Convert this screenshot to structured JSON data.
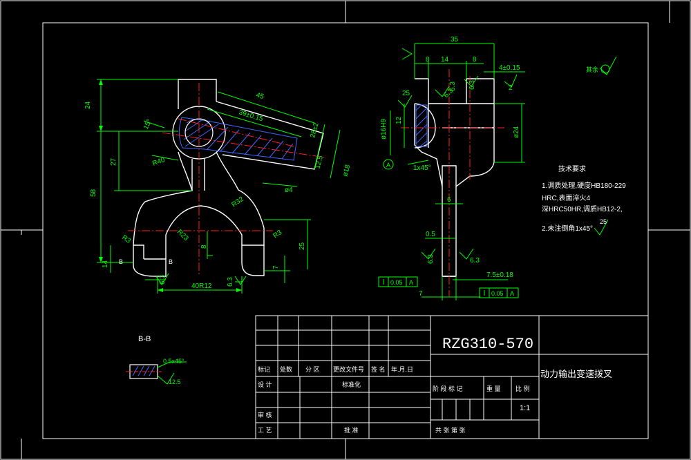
{
  "colors": {
    "background": "#000000",
    "outline": "#ffffff",
    "dimension": "#00ff00",
    "centerline": "#ff0000",
    "hatch": "#0000ff",
    "symbol": "#00ffff"
  },
  "title_block": {
    "drawing_number": "RZG310-570",
    "part_name": "动力输出变速拨叉",
    "scale": "1:1",
    "rev_header": {
      "mark": "标记",
      "count": "处数",
      "zone": "分 区",
      "doc": "更改文件号",
      "sign": "签 名",
      "date": "年.月.日"
    },
    "design": "设 计",
    "standardize": "标准化",
    "review": "审 核",
    "process": "工 艺",
    "approve": "批 准",
    "stage": "阶 段 标 记",
    "weight": "重 量",
    "ratio": "比 例",
    "sheet": "共     张  第     张"
  },
  "front_view": {
    "dims": {
      "d24": "24",
      "d27": "27",
      "d58": "58",
      "d15": "15°",
      "d45": "45",
      "d39": "39±0.15",
      "d28": "28±2",
      "d12_5": "12.5",
      "d18": "ø18",
      "dphi4": "ø4",
      "r40": "R40",
      "r32": "R32",
      "r23": "R23",
      "r3a": "R3",
      "r3b": "R3",
      "d8": "8",
      "d25": "25",
      "d7": "7",
      "d14": "14",
      "d40": "40R12",
      "ra63a": "6.3",
      "ra63b": "6.3",
      "bmark1": "B",
      "bmark2": "B"
    }
  },
  "side_view": {
    "dims": {
      "d35": "35",
      "d8a": "8",
      "d14t": "14",
      "d8b": "8",
      "d4": "4±0.15",
      "ra25": "25",
      "d12": "12",
      "d16h9": "ø16H9",
      "ra63a": "6.3",
      "ra63b": "6.3",
      "lx45": "1x45°",
      "d24": "ø24",
      "d6": "6",
      "d05": "0.5",
      "d75": "7.5±0.18",
      "d7a": "7",
      "ra63c": "6.3",
      "ra63d": "6.3",
      "ra63e": "6.3",
      "tol1": "0.05",
      "tol1ref": "A",
      "tol2": "0.05",
      "tol2ref": "A",
      "datum": "A",
      "ra2": "2"
    }
  },
  "notes": {
    "heading": "技术要求",
    "line1": "1.调质处理,硬度HB180-229",
    "line2": "HRC,表面淬火4",
    "line3": "深HRC50HR,调质HB12-2,",
    "line4": "2.未注倒角1x45°",
    "ra25": "25",
    "other": "其余"
  },
  "section": {
    "label": "B-B",
    "chamfer": "0.5x45°",
    "ra": "12.5"
  }
}
